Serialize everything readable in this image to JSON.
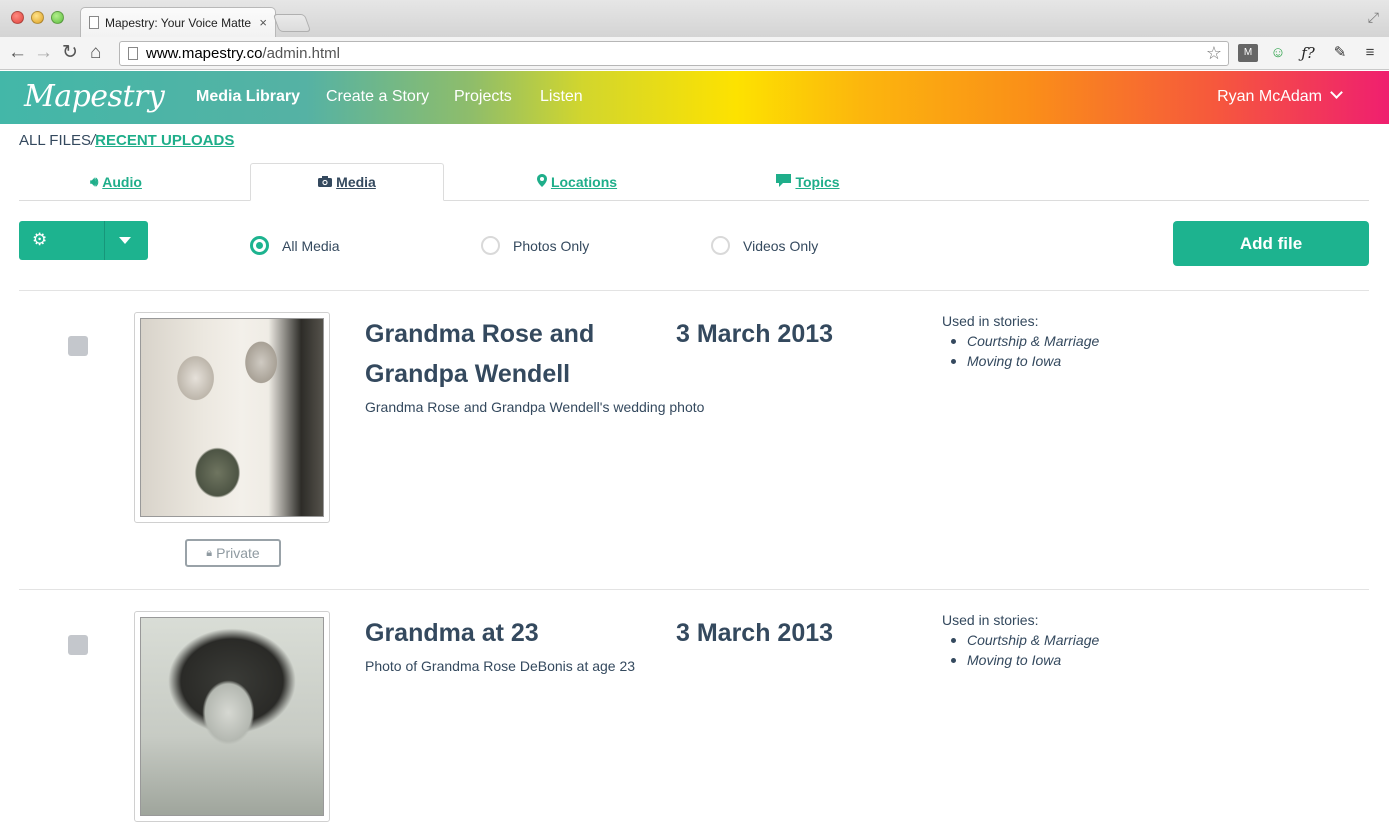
{
  "browser": {
    "tab_title": "Mapestry: Your Voice Matte",
    "tab_close": "×",
    "url_host": "www.mapestry.co",
    "url_path": "/admin.html"
  },
  "header": {
    "logo": "Mapestry",
    "nav": [
      {
        "label": "Media Library",
        "active": true
      },
      {
        "label": "Create a Story",
        "active": false
      },
      {
        "label": "Projects",
        "active": false
      },
      {
        "label": "Listen",
        "active": false
      }
    ],
    "user": "Ryan McAdam"
  },
  "breadcrumb": {
    "root": "ALL FILES",
    "separator": "/",
    "current": "RECENT UPLOADS"
  },
  "tabs": [
    {
      "label": "Audio",
      "icon": "speaker-icon"
    },
    {
      "label": "Media",
      "icon": "camera-icon"
    },
    {
      "label": "Locations",
      "icon": "map-pin-icon"
    },
    {
      "label": "Topics",
      "icon": "speech-bubble-icon"
    }
  ],
  "filters": {
    "options": [
      {
        "label": "All Media",
        "selected": true
      },
      {
        "label": "Photos Only",
        "selected": false
      },
      {
        "label": "Videos Only",
        "selected": false
      }
    ],
    "add_file_label": "Add file"
  },
  "media_items": [
    {
      "title": "Grandma Rose and Grandpa Wendell",
      "date": "3 March 2013",
      "description": "Grandma Rose and Grandpa Wendell's wedding photo",
      "privacy_label": "Private",
      "used_in_label": "Used in stories:",
      "stories": [
        "Courtship & Marriage",
        "Moving to Iowa"
      ]
    },
    {
      "title": "Grandma at 23",
      "date": "3 March 2013",
      "description": "Photo of Grandma Rose DeBonis at age 23",
      "used_in_label": "Used in stories:",
      "stories": [
        "Courtship & Marriage",
        "Moving to Iowa"
      ]
    }
  ],
  "colors": {
    "accent": "#1db38f",
    "text": "#34495e",
    "link": "#1fae8a"
  }
}
